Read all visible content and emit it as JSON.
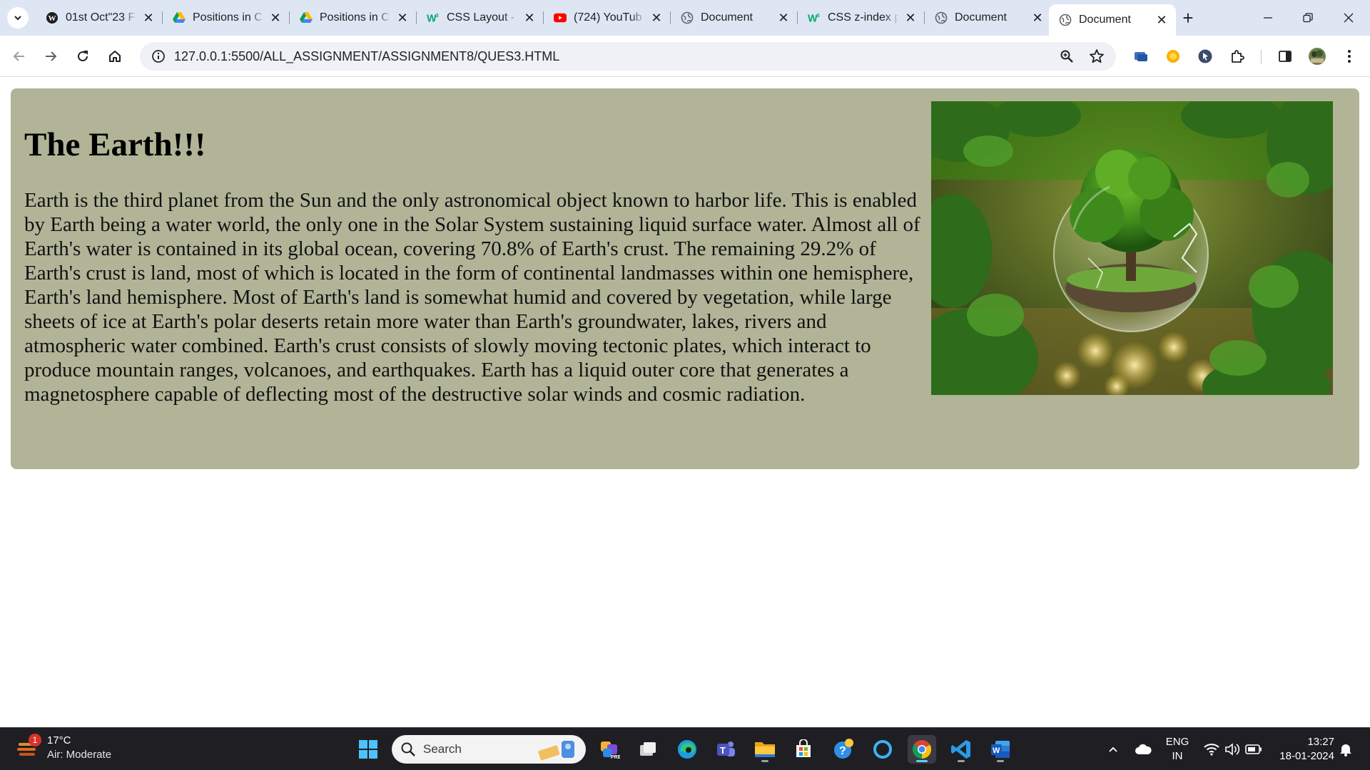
{
  "browser": {
    "tabs": [
      {
        "title": "01st Oct\"23 F",
        "icon": "wordpress-icon"
      },
      {
        "title": "Positions in C",
        "icon": "google-drive-icon"
      },
      {
        "title": "Positions in C",
        "icon": "google-drive-icon"
      },
      {
        "title": "CSS Layout -",
        "icon": "w3schools-icon"
      },
      {
        "title": "(724) YouTub",
        "icon": "youtube-icon"
      },
      {
        "title": "Document",
        "icon": "globe-icon"
      },
      {
        "title": "CSS z-index p",
        "icon": "w3schools-icon"
      },
      {
        "title": "Document",
        "icon": "globe-icon"
      },
      {
        "title": "Document",
        "icon": "globe-icon",
        "active": true
      }
    ],
    "address": "127.0.0.1:5500/ALL_ASSIGNMENT/ASSIGNMENT8/QUES3.HTML"
  },
  "page": {
    "title": "The Earth!!!",
    "paragraph": "Earth is the third planet from the Sun and the only astronomical object known to harbor life. This is enabled by Earth being a water world, the only one in the Solar System sustaining liquid surface water. Almost all of Earth's water is contained in its global ocean, covering 70.8% of Earth's crust. The remaining 29.2% of Earth's crust is land, most of which is located in the form of continental landmasses within one hemisphere, Earth's land hemisphere. Most of Earth's land is somewhat humid and covered by vegetation, while large sheets of ice at Earth's polar deserts retain more water than Earth's groundwater, lakes, rivers and atmospheric water combined. Earth's crust consists of slowly moving tectonic plates, which interact to produce mountain ranges, volcanoes, and earthquakes. Earth has a liquid outer core that generates a magnetosphere capable of deflecting most of the destructive solar winds and cosmic radiation.",
    "card_color": "#b1b497"
  },
  "taskbar": {
    "weather_badge": "1",
    "temperature": "17°C",
    "air_quality": "Air: Moderate",
    "search_label": "Search",
    "lang_line1": "ENG",
    "lang_line2": "IN",
    "time": "13:27",
    "date": "18-01-2024"
  }
}
